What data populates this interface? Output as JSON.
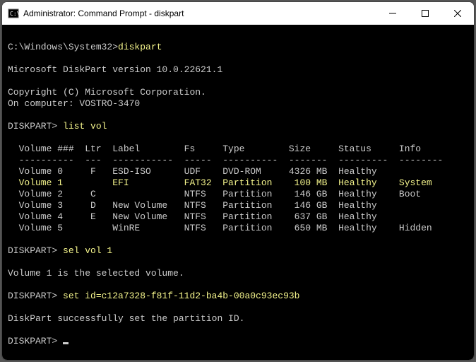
{
  "titlebar": {
    "title": "Administrator: Command Prompt - diskpart"
  },
  "prompt_path": "C:\\Windows\\System32>",
  "cmd_diskpart": "diskpart",
  "version_line": "Microsoft DiskPart version 10.0.22621.1",
  "copyright_line": "Copyright (C) Microsoft Corporation.",
  "computer_line": "On computer: VOSTRO-3470",
  "dp_prompt": "DISKPART> ",
  "cmd_list_vol": "list vol",
  "table": {
    "header": "  Volume ###  Ltr  Label        Fs     Type        Size     Status     Info",
    "divider": "  ----------  ---  -----------  -----  ----------  -------  ---------  --------",
    "rows": [
      "  Volume 0     F   ESD-ISO      UDF    DVD-ROM     4326 MB  Healthy",
      "  Volume 2     C                NTFS   Partition    146 GB  Healthy    Boot",
      "  Volume 3     D   New Volume   NTFS   Partition    146 GB  Healthy",
      "  Volume 4     E   New Volume   NTFS   Partition    637 GB  Healthy",
      "  Volume 5         WinRE        NTFS   Partition    650 MB  Healthy    Hidden"
    ],
    "row_hl_a": "  Volume 1         EFI          FAT32  Partition   ",
    "row_hl_b": " 100 MB  Healthy    ",
    "row_hl_c": "System"
  },
  "cmd_sel_vol": "sel vol 1",
  "sel_response": "Volume 1 is the selected volume.",
  "cmd_set_id": "set id=c12a7328-f81f-11d2-ba4b-00a0c93ec93b",
  "set_response": "DiskPart successfully set the partition ID."
}
